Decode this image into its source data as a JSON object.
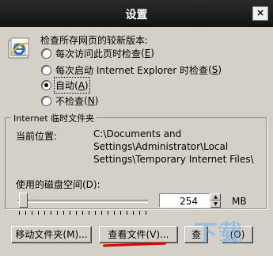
{
  "dialog": {
    "title": "设置",
    "close_glyph": "×"
  },
  "check": {
    "label": "检查所存网页的较新版本:",
    "options": [
      {
        "label": "每次访问此页时检查",
        "key": "E",
        "checked": false
      },
      {
        "label": "每次启动 Internet Explorer 时检查",
        "key": "S",
        "checked": false
      },
      {
        "label": "自动",
        "key": "A",
        "checked": true
      },
      {
        "label": "不检查",
        "key": "N",
        "checked": false
      }
    ]
  },
  "temp": {
    "group_title": "Internet 临时文件夹",
    "location_label": "当前位置:",
    "location_lines": [
      "C:\\Documents and",
      "Settings\\Administrator\\Local",
      "Settings\\Temporary Internet Files\\"
    ],
    "disk_label": "使用的磁盘空间(D):",
    "disk_value": "254",
    "disk_unit": "MB",
    "slider_fraction": 0.02
  },
  "buttons": {
    "move": "移动文件夹(M)...",
    "view_files": "查看文件(V)...",
    "view_objects": "查",
    "objects_key": "(O)"
  },
  "watermark": "下载",
  "colors": {
    "dialog_bg": "#d4d0c8",
    "titlebar": "#1e1e1e",
    "red_mark": "#e00000"
  },
  "icons": [
    "ie-logo-icon",
    "close-icon",
    "spin-up-icon",
    "spin-down-icon"
  ]
}
